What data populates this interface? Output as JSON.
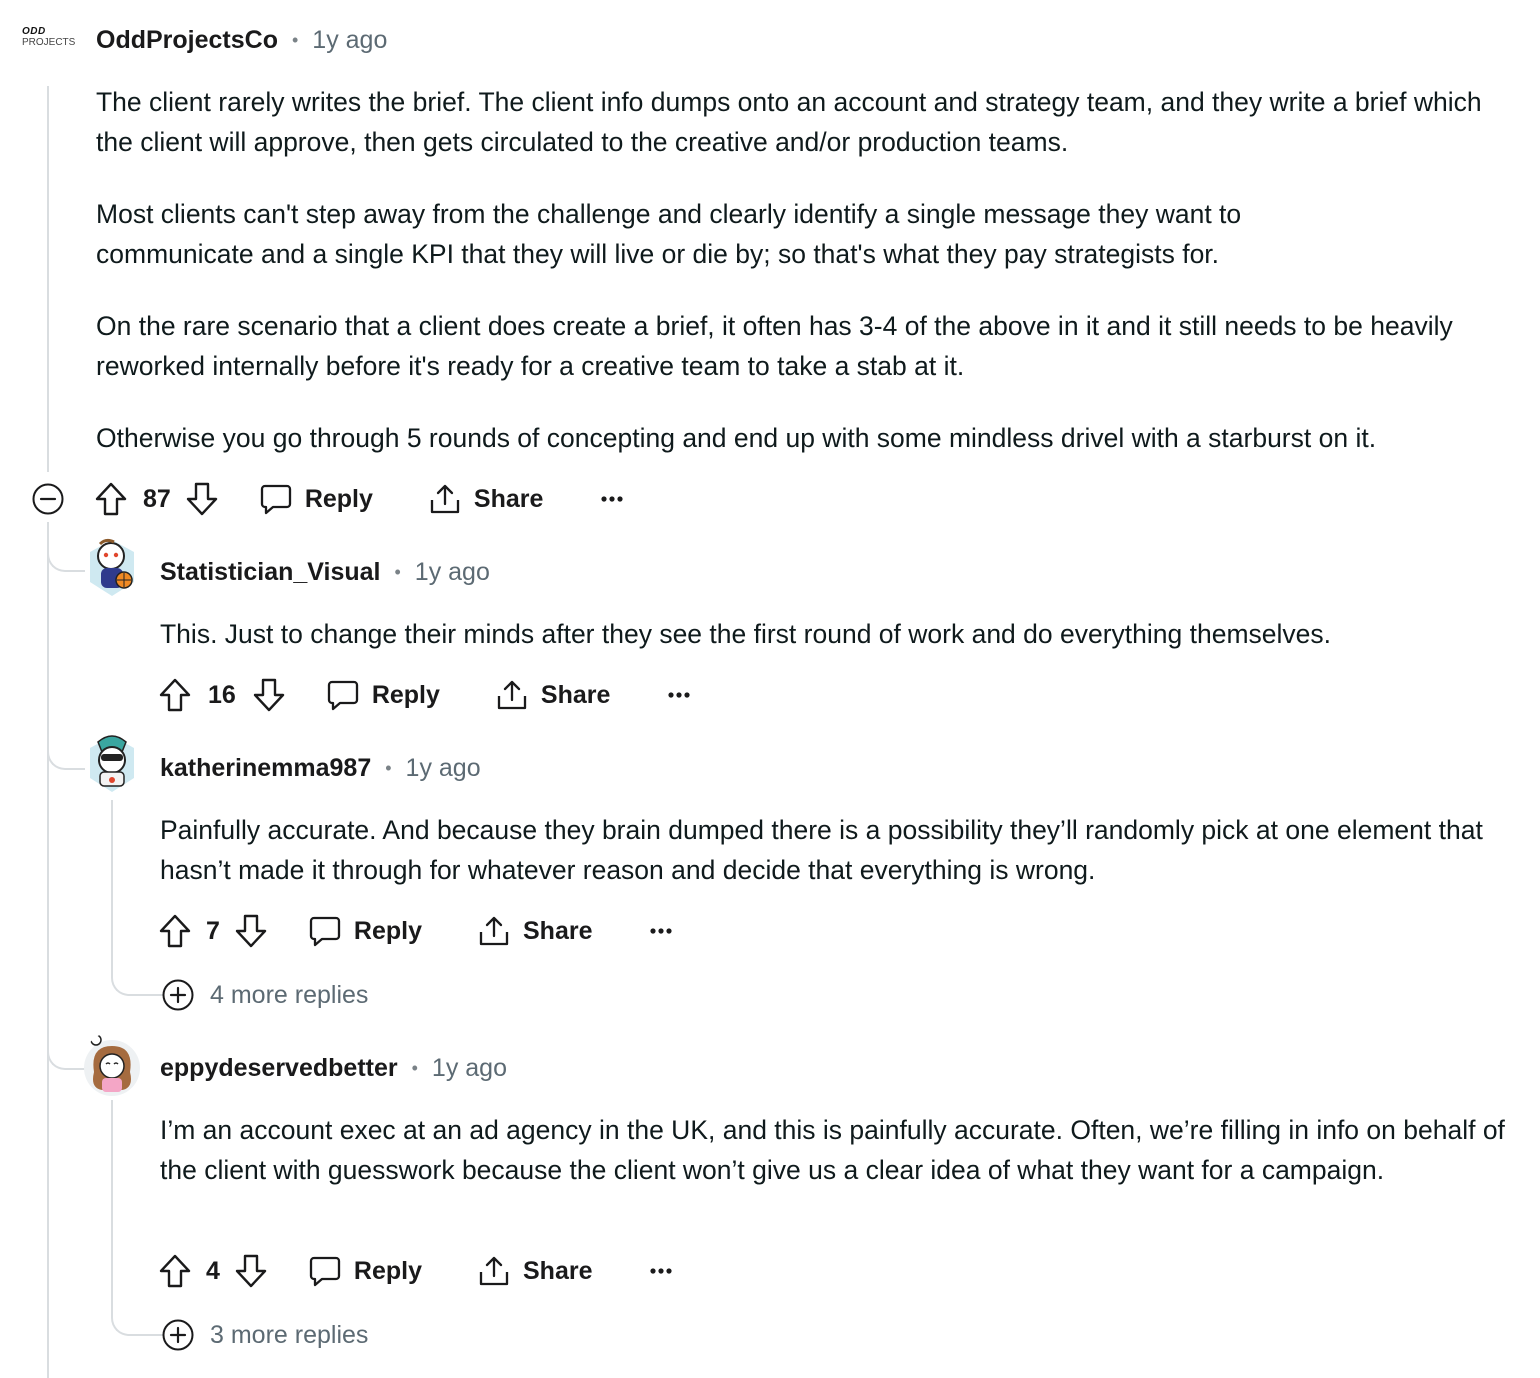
{
  "thread": {
    "root": {
      "logo_top": "ODD",
      "logo_bottom": "PROJECTS",
      "username": "OddProjectsCo",
      "time": "1y ago",
      "paragraphs": [
        "The client rarely writes the brief. The client info dumps onto an account and strategy team, and they write a brief which the client will approve, then gets circulated to the creative and/or production teams.",
        "Most clients can't step away from the challenge and clearly identify a single message they want to communicate and a single KPI that they will live or die by; so that's what they pay strategists for.",
        "On the rare scenario that a client does create a brief, it often has 3-4 of the above in it and it still needs to be heavily reworked internally before it's ready for a creative team to take a stab at it.",
        "Otherwise you go through 5 rounds of concepting and end up with some mindless drivel with a starburst on it."
      ],
      "votes": "87",
      "reply_label": "Reply",
      "share_label": "Share"
    },
    "replies": [
      {
        "username": "Statistician_Visual",
        "time": "1y ago",
        "paragraphs": [
          "This. Just to change their minds after they see the first round of work and do everything themselves."
        ],
        "votes": "16",
        "reply_label": "Reply",
        "share_label": "Share"
      },
      {
        "username": "katherinemma987",
        "time": "1y ago",
        "paragraphs": [
          "Painfully accurate. And because they brain dumped there is a possibility they’ll randomly pick at one element that hasn’t made it through for whatever reason and decide that everything is wrong."
        ],
        "votes": "7",
        "reply_label": "Reply",
        "share_label": "Share",
        "more_replies": "4 more replies"
      },
      {
        "username": "eppydeservedbetter",
        "time": "1y ago",
        "paragraphs": [
          "I’m an account exec at an ad agency in the UK, and this is painfully accurate. Often, we’re filling in info on behalf of the client with guesswork because the client won’t give us a clear idea of what they want for a campaign."
        ],
        "votes": "4",
        "reply_label": "Reply",
        "share_label": "Share",
        "more_replies": "3 more replies"
      }
    ]
  },
  "icons": {
    "collapse": "minus-circle-icon",
    "upvote": "arrow-up-icon",
    "downvote": "arrow-down-icon",
    "reply": "speech-bubble-icon",
    "share": "share-upload-icon",
    "more": "ellipsis-icon",
    "expand": "plus-circle-icon"
  },
  "colors": {
    "text": "#0f1a1c",
    "muted": "#5c6a73",
    "thread_line": "#d9dde0"
  }
}
